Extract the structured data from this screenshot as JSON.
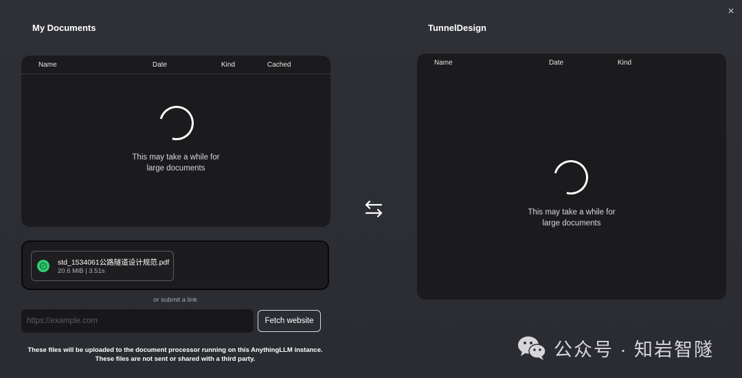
{
  "left": {
    "title": "My Documents",
    "columns": [
      "Name",
      "Date",
      "Kind",
      "Cached"
    ],
    "loading_text_line1": "This may take a while for",
    "loading_text_line2": "large documents"
  },
  "right": {
    "title": "TunnelDesign",
    "columns": [
      "Name",
      "Date",
      "Kind"
    ],
    "loading_text_line1": "This may take a while for",
    "loading_text_line2": "large documents"
  },
  "close_icon": "×",
  "upload": {
    "file_name": "std_1534061公路隧道设计规范.pdf",
    "file_meta": "20.6 MiB | 3.51s",
    "status_icon": "check-circle-icon",
    "status_color": "#2ecc71"
  },
  "link": {
    "or_text": "or submit a link",
    "placeholder": "https://example.com",
    "value": "",
    "button_label": "Fetch website"
  },
  "footnote": {
    "line1": "These files will be uploaded to the document processor running on this AnythingLLM instance.",
    "line2": "These files are not sent or shared with a third party."
  },
  "swap_icon": "swap-arrows-icon",
  "watermark": {
    "text": "公众号 · 知岩智隧"
  }
}
